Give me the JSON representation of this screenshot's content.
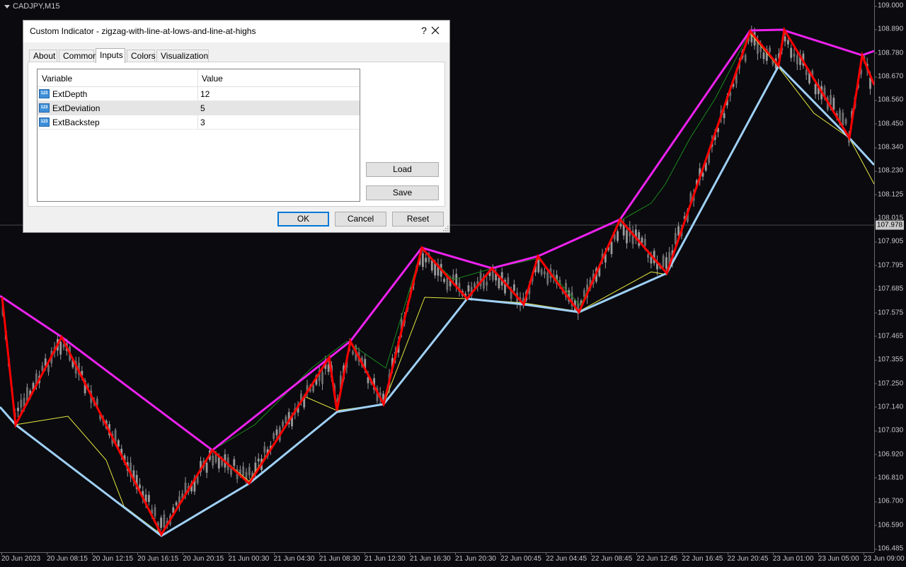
{
  "chart": {
    "symbol_label": "CADJPY,M15",
    "price_badge": "107.978",
    "y_axis_ticks": [
      "109.000",
      "108.890",
      "108.780",
      "108.670",
      "108.560",
      "108.450",
      "108.340",
      "108.230",
      "108.125",
      "108.015",
      "107.905",
      "107.795",
      "107.685",
      "107.575",
      "107.465",
      "107.355",
      "107.250",
      "107.140",
      "107.030",
      "106.920",
      "106.810",
      "106.700",
      "106.590",
      "106.485"
    ],
    "x_axis_ticks": [
      "20 Jun 2023",
      "20 Jun 08:15",
      "20 Jun 12:15",
      "20 Jun 16:15",
      "20 Jun 20:15",
      "21 Jun 00:30",
      "21 Jun 04:30",
      "21 Jun 08:30",
      "21 Jun 12:30",
      "21 Jun 16:30",
      "21 Jun 20:30",
      "22 Jun 00:45",
      "22 Jun 04:45",
      "22 Jun 08:45",
      "22 Jun 12:45",
      "22 Jun 16:45",
      "22 Jun 20:45",
      "23 Jun 01:00",
      "23 Jun 05:00",
      "23 Jun 09:00"
    ],
    "colors": {
      "background": "#0a0a0f",
      "candles": "#9a9a9a",
      "zigzag": "#ff0000",
      "highs_line": "#ee22ee",
      "lows_line": "#9fd0f5",
      "thin_yellow": "#e8e840",
      "thin_green": "#1a8a1a"
    }
  },
  "dialog": {
    "title": "Custom Indicator - zigzag-with-line-at-lows-and-line-at-highs",
    "help": "?",
    "tabs": [
      "About",
      "Common",
      "Inputs",
      "Colors",
      "Visualization"
    ],
    "active_tab": "Inputs",
    "grid": {
      "headers": {
        "variable": "Variable",
        "value": "Value"
      },
      "rows": [
        {
          "name": "ExtDepth",
          "value": "12"
        },
        {
          "name": "ExtDeviation",
          "value": "5"
        },
        {
          "name": "ExtBackstep",
          "value": "3"
        }
      ],
      "icon_text": "123"
    },
    "buttons": {
      "load": "Load",
      "save": "Save",
      "ok": "OK",
      "cancel": "Cancel",
      "reset": "Reset"
    }
  }
}
